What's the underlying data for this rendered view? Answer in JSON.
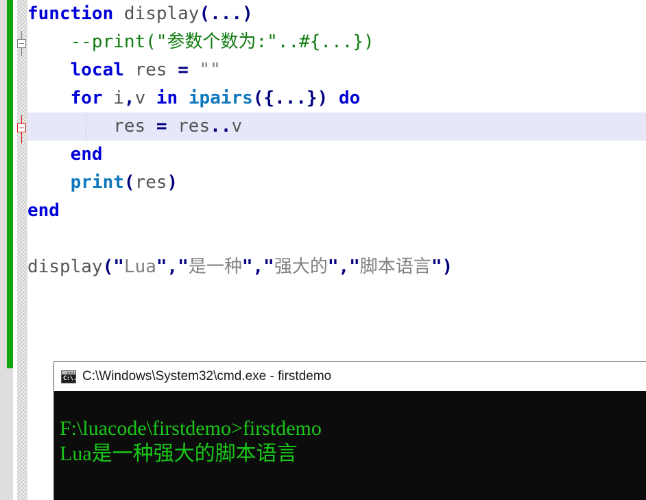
{
  "editor": {
    "change_bar_color": "#11a50d",
    "current_line_highlight": "#e7e7fa",
    "fold_markers": [
      {
        "name": "fold-function",
        "color": "#808080",
        "state": "expanded"
      },
      {
        "name": "fold-for",
        "color": "#d81b1b",
        "state": "expanded"
      }
    ],
    "lines": [
      {
        "id": "line-function",
        "tokens": [
          {
            "t": "function",
            "c": "kw"
          },
          {
            "t": " ",
            "c": "id"
          },
          {
            "t": "display",
            "c": "id"
          },
          {
            "t": "(...)",
            "c": "op"
          }
        ]
      },
      {
        "id": "line-comment",
        "tokens": [
          {
            "t": "    --print(\"参数个数为:\"..#{...})",
            "c": "cmt"
          }
        ]
      },
      {
        "id": "line-local",
        "tokens": [
          {
            "t": "    ",
            "c": "id"
          },
          {
            "t": "local",
            "c": "kw"
          },
          {
            "t": " res ",
            "c": "id"
          },
          {
            "t": "=",
            "c": "op"
          },
          {
            "t": " ",
            "c": "id"
          },
          {
            "t": "\"\"",
            "c": "str"
          }
        ]
      },
      {
        "id": "line-for",
        "tokens": [
          {
            "t": "    ",
            "c": "id"
          },
          {
            "t": "for",
            "c": "kw"
          },
          {
            "t": " i",
            "c": "id"
          },
          {
            "t": ",",
            "c": "op"
          },
          {
            "t": "v ",
            "c": "id"
          },
          {
            "t": "in",
            "c": "kw"
          },
          {
            "t": " ",
            "c": "id"
          },
          {
            "t": "ipairs",
            "c": "bi"
          },
          {
            "t": "({...})",
            "c": "op"
          },
          {
            "t": " ",
            "c": "id"
          },
          {
            "t": "do",
            "c": "kw"
          }
        ]
      },
      {
        "id": "line-res-assign",
        "current": true,
        "tokens": [
          {
            "t": "        res ",
            "c": "id"
          },
          {
            "t": "=",
            "c": "op"
          },
          {
            "t": " res",
            "c": "id"
          },
          {
            "t": "..",
            "c": "op"
          },
          {
            "t": "v",
            "c": "id"
          }
        ]
      },
      {
        "id": "line-end-inner",
        "tokens": [
          {
            "t": "    ",
            "c": "id"
          },
          {
            "t": "end",
            "c": "kw"
          }
        ]
      },
      {
        "id": "line-print",
        "tokens": [
          {
            "t": "    ",
            "c": "id"
          },
          {
            "t": "print",
            "c": "bi"
          },
          {
            "t": "(",
            "c": "op"
          },
          {
            "t": "res",
            "c": "id"
          },
          {
            "t": ")",
            "c": "op"
          }
        ]
      },
      {
        "id": "line-end-outer",
        "tokens": [
          {
            "t": "end",
            "c": "kw"
          }
        ]
      },
      {
        "id": "line-blank-1",
        "tokens": []
      },
      {
        "id": "line-call-display",
        "tokens": [
          {
            "t": "display",
            "c": "id"
          },
          {
            "t": "(",
            "c": "op"
          },
          {
            "t": "\"",
            "c": "op"
          },
          {
            "t": "Lua",
            "c": "str"
          },
          {
            "t": "\"",
            "c": "op"
          },
          {
            "t": ",",
            "c": "op"
          },
          {
            "t": "\"",
            "c": "op"
          },
          {
            "t": "是一种",
            "c": "str"
          },
          {
            "t": "\"",
            "c": "op"
          },
          {
            "t": ",",
            "c": "op"
          },
          {
            "t": "\"",
            "c": "op"
          },
          {
            "t": "强大的",
            "c": "str"
          },
          {
            "t": "\"",
            "c": "op"
          },
          {
            "t": ",",
            "c": "op"
          },
          {
            "t": "\"",
            "c": "op"
          },
          {
            "t": "脚本语言",
            "c": "str"
          },
          {
            "t": "\"",
            "c": "op"
          },
          {
            "t": ")",
            "c": "op"
          }
        ]
      }
    ]
  },
  "console": {
    "title": "C:\\Windows\\System32\\cmd.exe - firstdemo",
    "icon": "cmd-prompt-icon",
    "icon_text": "C:\\.",
    "text_color": "#18c818",
    "background": "#0c0c0c",
    "output": [
      "F:\\luacode\\firstdemo>firstdemo",
      "Lua是一种强大的脚本语言"
    ]
  }
}
